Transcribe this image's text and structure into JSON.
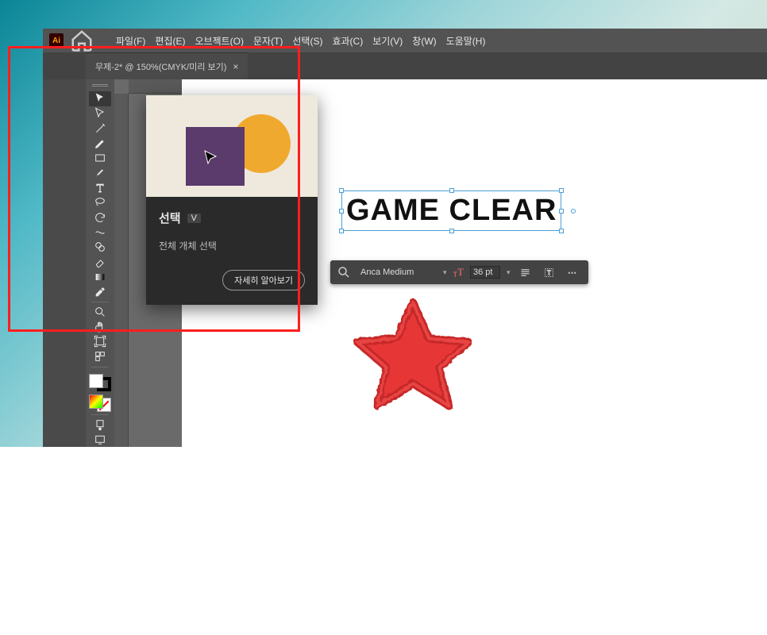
{
  "menu": [
    "파일(F)",
    "편집(E)",
    "오브젝트(O)",
    "문자(T)",
    "선택(S)",
    "효과(C)",
    "보기(V)",
    "창(W)",
    "도움말(H)"
  ],
  "tab": {
    "title": "무제-2* @ 150%(CMYK/미리 보기)"
  },
  "tooltip": {
    "title": "선택",
    "key": "V",
    "subtitle": "전체 개체 선택",
    "learn_more": "자세히 알아보기"
  },
  "artwork": {
    "text": "GAME CLEAR"
  },
  "ctx": {
    "font": "Anca Medium",
    "size": "36 pt"
  }
}
